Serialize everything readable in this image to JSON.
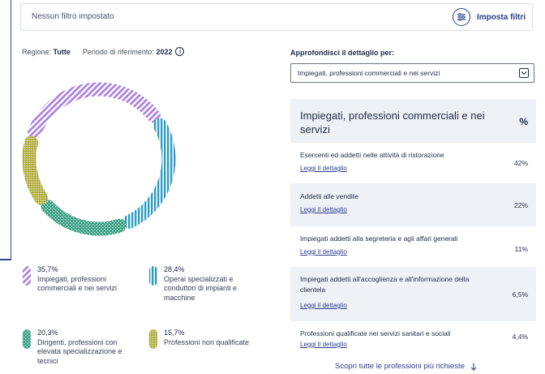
{
  "filter_bar": {
    "text": "Nessun filtro impostato",
    "button_label": "Imposta filtri"
  },
  "region": {
    "label": "Regione:",
    "value": "Tutte",
    "period_label": "Periodo di riferimento:",
    "period_value": "2022",
    "info": "i"
  },
  "chart_data": {
    "type": "pie",
    "variant": "donut",
    "values": [
      35.7,
      28.4,
      20.3,
      15.7
    ],
    "categories": [
      "Impiegati, professioni commerciali e nei servizi",
      "Operai specializzati e conduttori di impianti e macchine",
      "Dirigenti, professioni con elevata specializzazione e tecnici",
      "Professioni non qualificate"
    ],
    "colors": [
      "#a97ee0",
      "#2c9cc6",
      "#2f9a7c",
      "#a7a52a"
    ],
    "patterns": [
      "diagonal",
      "vertical",
      "checker",
      "diagonal-cross"
    ]
  },
  "legend": [
    {
      "pct": "35,7%",
      "label": "Impiegati, professioni commerciali e nei servizi"
    },
    {
      "pct": "28,4%",
      "label": "Operai specializzati e conduttori di impianti e macchine"
    },
    {
      "pct": "20,3%",
      "label": "Dirigenti, professioni con elevata specializzazione e tecnici"
    },
    {
      "pct": "15,7%",
      "label": "Professioni non qualificate"
    }
  ],
  "detail": {
    "label": "Approfondisci il dettaglio per:",
    "selected": "Impiegati, professioni commerciali e nei servizi",
    "table_title": "Impiegati, professioni commerciali e nei servizi",
    "pct_header": "%",
    "link_label": "Leggi il dettaglio",
    "rows": [
      {
        "name": "Esercenti ed addetti nelle attività di ristorazione",
        "value": "42%"
      },
      {
        "name": "Addetti alle vendite",
        "value": "22%"
      },
      {
        "name": "Impiegati addetti alla segreteria e agli affari generali",
        "value": "11%"
      },
      {
        "name": "Impiegati addetti all'accoglienza e all'informazione della clientela",
        "value": "6,5%"
      },
      {
        "name": "Professioni qualificate nei servizi sanitari e sociali",
        "value": "4,4%"
      }
    ]
  },
  "discover_link": "Scopri tutte le professioni più richieste"
}
